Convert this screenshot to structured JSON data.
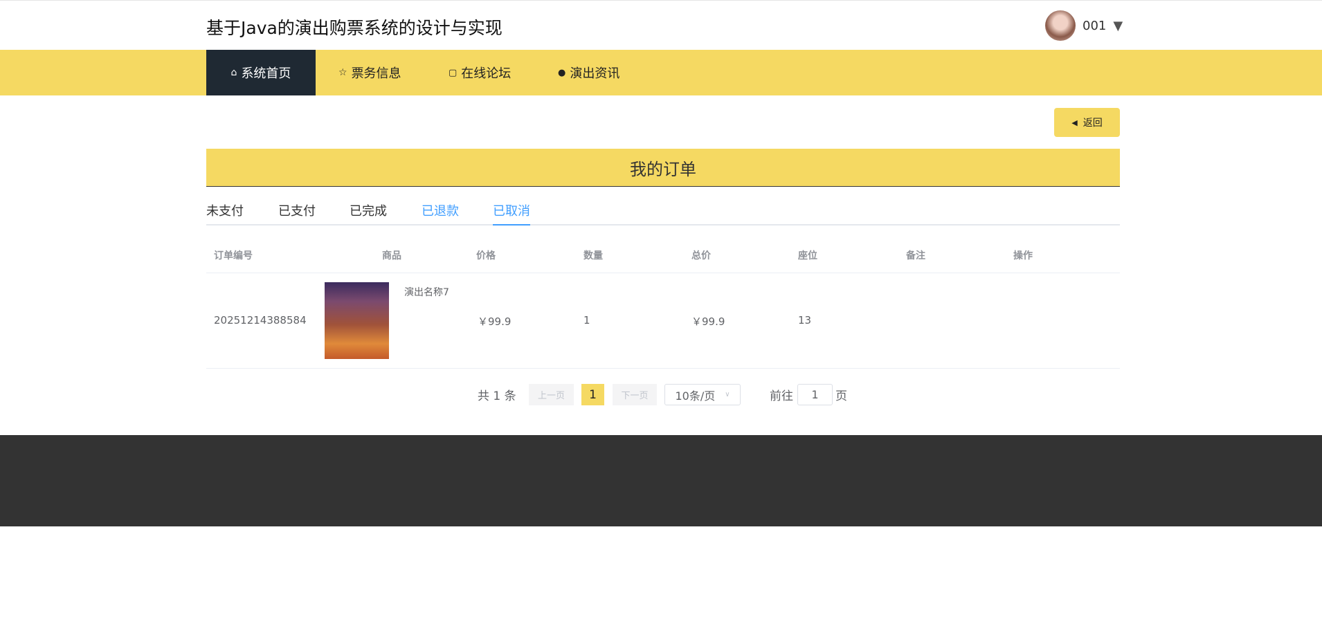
{
  "header": {
    "title": "基于Java的演出购票系统的设计与实现",
    "username": "001"
  },
  "nav": [
    {
      "label": "系统首页",
      "icon": "home-icon"
    },
    {
      "label": "票务信息",
      "icon": "star-icon"
    },
    {
      "label": "在线论坛",
      "icon": "bag-icon"
    },
    {
      "label": "演出资讯",
      "icon": "info-icon"
    }
  ],
  "back_label": "返回",
  "banner_title": "我的订单",
  "tabs": [
    "未支付",
    "已支付",
    "已完成",
    "已退款",
    "已取消"
  ],
  "active_tab": "已取消",
  "table": {
    "headers": [
      "订单编号",
      "商品",
      "价格",
      "数量",
      "总价",
      "座位",
      "备注",
      "操作"
    ],
    "rows": [
      {
        "order_no": "20251214388584",
        "product": "演出名称7",
        "price": "￥99.9",
        "qty": "1",
        "total": "￥99.9",
        "seat": "13",
        "note": "",
        "action": ""
      }
    ]
  },
  "pagination": {
    "total": "共 1 条",
    "prev": "上一页",
    "page": "1",
    "next": "下一页",
    "size": "10条/页",
    "goto": "前往",
    "goto_value": "1",
    "page_unit": "页"
  },
  "colors": {
    "accent": "#f5d962",
    "nav_active": "#1f2933",
    "tab_active": "#409eff",
    "footer": "#333333"
  }
}
